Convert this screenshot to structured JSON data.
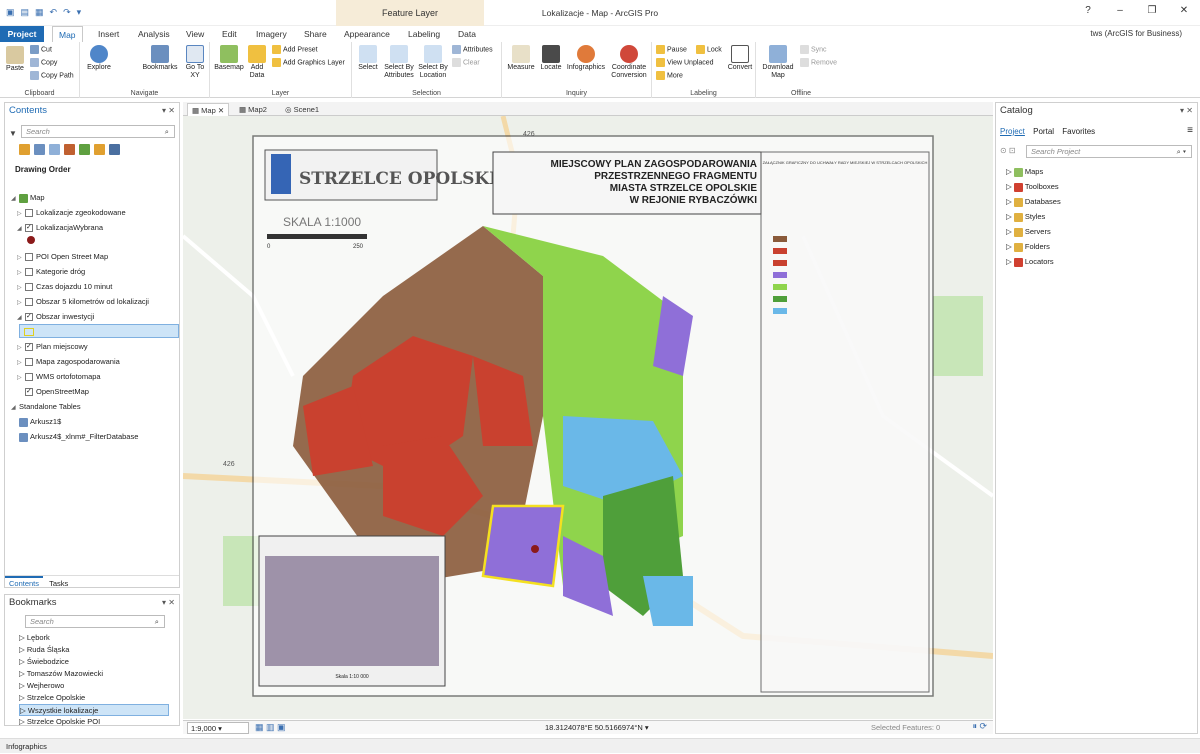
{
  "window": {
    "title": "Lokalizacje - Map - ArcGIS Pro",
    "contextual_tab_group": "Feature Layer",
    "controls": [
      "?",
      "–",
      "❐",
      "✕"
    ],
    "user": "tws (ArcGIS for Business)"
  },
  "tabs": [
    {
      "label": "Project"
    },
    {
      "label": "Map"
    },
    {
      "label": "Insert"
    },
    {
      "label": "Analysis"
    },
    {
      "label": "View"
    },
    {
      "label": "Edit"
    },
    {
      "label": "Imagery"
    },
    {
      "label": "Share"
    },
    {
      "label": "Appearance"
    },
    {
      "label": "Labeling"
    },
    {
      "label": "Data"
    }
  ],
  "ribbon": {
    "clipboard": {
      "label": "Clipboard",
      "paste": "Paste",
      "cut": "Cut",
      "copy": "Copy",
      "copy_path": "Copy Path"
    },
    "navigate": {
      "label": "Navigate",
      "explore": "Explore",
      "bookmarks": "Bookmarks",
      "go_to_xy": "Go To XY"
    },
    "layer": {
      "label": "Layer",
      "basemap": "Basemap",
      "add_data": "Add Data",
      "add_preset": "Add Preset",
      "add_graphics": "Add Graphics Layer"
    },
    "selection": {
      "label": "Selection",
      "select": "Select",
      "by_attributes": "Select By Attributes",
      "by_location": "Select By Location",
      "attributes": "Attributes",
      "clear": "Clear"
    },
    "inquiry": {
      "label": "Inquiry",
      "measure": "Measure",
      "locate": "Locate",
      "infographics": "Infographics",
      "coord_conv": "Coordinate Conversion"
    },
    "labeling": {
      "label": "Labeling",
      "pause": "Pause",
      "lock": "Lock",
      "view_unplaced": "View Unplaced",
      "more": "More",
      "convert": "Convert"
    },
    "offline": {
      "label": "Offline",
      "download": "Download Map",
      "sync": "Sync",
      "remove": "Remove"
    }
  },
  "contents": {
    "title": "Contents",
    "search_placeholder": "Search",
    "drawing_order": "Drawing Order",
    "layers": [
      {
        "label": "Map",
        "checked": true,
        "expanded": true
      },
      {
        "label": "Lokalizacje zgeokodowane",
        "checked": false
      },
      {
        "label": "LokalizacjaWybrana",
        "checked": true,
        "expanded": true
      },
      {
        "label": "POI Open Street Map",
        "checked": false
      },
      {
        "label": "Kategorie dróg",
        "checked": false
      },
      {
        "label": "Czas dojazdu 10 minut",
        "checked": false
      },
      {
        "label": "Obszar 5 kilometrów od lokalizacji",
        "checked": false
      },
      {
        "label": "Obszar inwestycji",
        "checked": true,
        "expanded": true
      },
      {
        "label": "Plan miejscowy",
        "checked": true
      },
      {
        "label": "Mapa zagospodarowania",
        "checked": false
      },
      {
        "label": "WMS ortofotomapa",
        "checked": false
      },
      {
        "label": "OpenStreetMap",
        "checked": true
      }
    ],
    "standalone_label": "Standalone Tables",
    "tables": [
      "Arkusz1$",
      "Arkusz4$_xlnm#_FilterDatabase"
    ],
    "bottom_tabs": [
      "Contents",
      "Tasks"
    ]
  },
  "bookmarks": {
    "title": "Bookmarks",
    "search_placeholder": "Search",
    "items": [
      "Lębork",
      "Ruda Śląska",
      "Świebodzice",
      "Tomaszów Mazowiecki",
      "Wejherowo",
      "Strzelce Opolskie",
      "Wszystkie lokalizacje",
      "Strzelce Opolskie POI"
    ]
  },
  "map": {
    "tabs": [
      "Map",
      "Map2",
      "Scene1"
    ],
    "plan_title_lines": [
      "MIEJSCOWY PLAN ZAGOSPODAROWANIA",
      "PRZESTRZENNEGO FRAGMENTU",
      "MIASTA STRZELCE OPOLSKIE",
      "W REJONIE RYBACZÓWKI"
    ],
    "logo_text": "STRZELCE OPOLSKIE",
    "scale_text": "SKALA 1:1000",
    "scale_ticks": [
      "0",
      "250"
    ],
    "road_labels": [
      "426",
      "426"
    ],
    "legend_header": "ZAŁĄCZNIK GRAFICZNY DO UCHWAŁY RADY MIEJSKIEJ W STRZELCACH OPOLSKICH",
    "inset_caption": "Skala 1:10 000",
    "zone_colors": {
      "residential": "#c9412f",
      "mixed": "#8a5a3a",
      "green": "#8fd44c",
      "water": "#6ab8e8",
      "services": "#8f6fd8",
      "forest": "#4f9f3a"
    }
  },
  "status": {
    "scale": "1:9,000",
    "coordinates": "18.3124078°E 50.5166974°N",
    "selected": "Selected Features: 0"
  },
  "catalog": {
    "title": "Catalog",
    "tabs": [
      "Project",
      "Portal",
      "Favorites"
    ],
    "search_placeholder": "Search Project",
    "items": [
      "Maps",
      "Toolboxes",
      "Databases",
      "Styles",
      "Servers",
      "Folders",
      "Locators"
    ]
  },
  "bottom_status": "Infographics"
}
